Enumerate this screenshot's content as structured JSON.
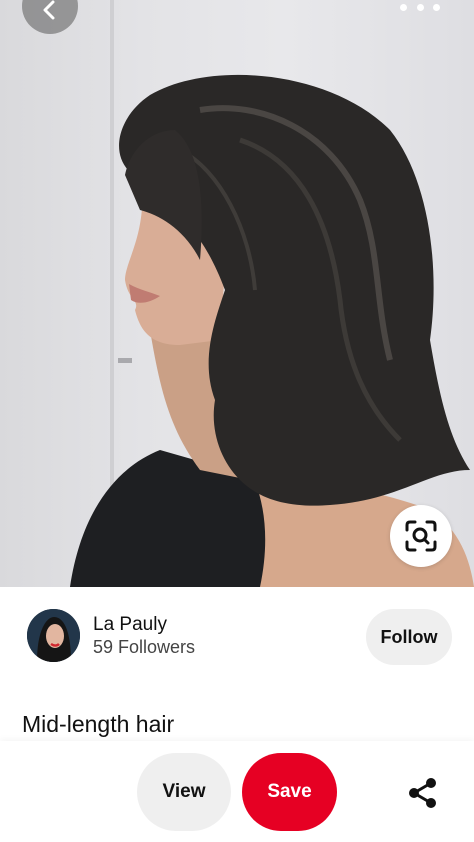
{
  "pin": {
    "image_alt": "Woman with layered mid-length dark hair in profile",
    "title": "Mid-length hair"
  },
  "author": {
    "name": "La Pauly",
    "followers": "59 Followers",
    "follow_label": "Follow"
  },
  "actions": {
    "view_label": "View",
    "save_label": "Save"
  },
  "icons": {
    "back": "chevron-left-icon",
    "more": "more-horizontal-icon",
    "lens": "visual-search-icon",
    "share": "share-icon"
  },
  "colors": {
    "save": "#e60023",
    "pill": "#efefef",
    "text": "#111111"
  }
}
